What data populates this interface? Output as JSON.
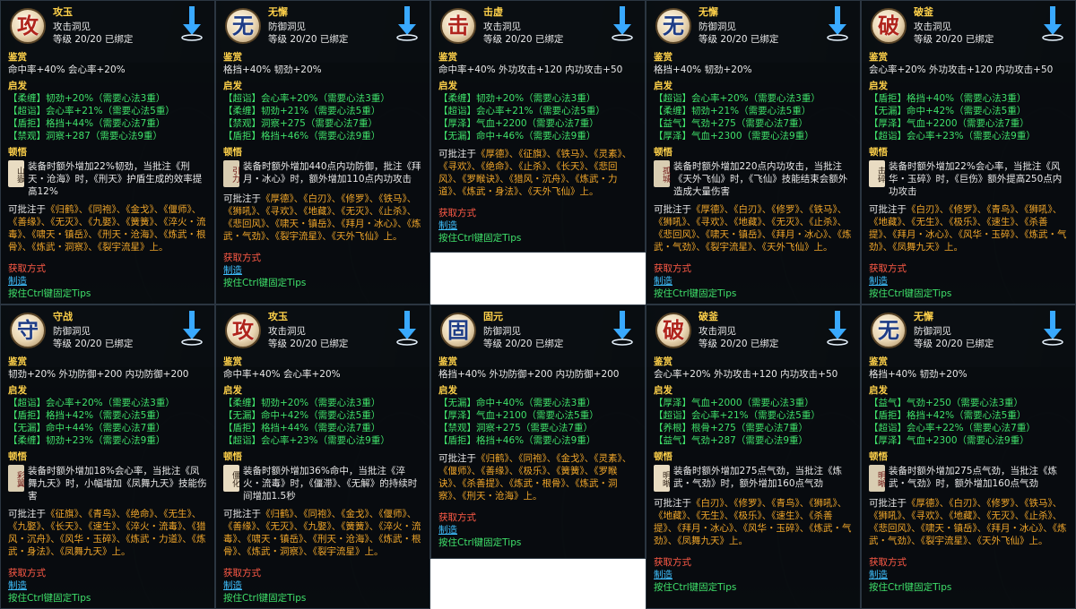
{
  "labels": {
    "appreciate": "鉴赏",
    "inspire": "启发",
    "insight": "顿悟",
    "acquire": "获取方式",
    "make": "制造",
    "hint": "按住Ctrl键固定Tips",
    "can_batch": "可批注于"
  },
  "tooltips": [
    {
      "glyph": "攻",
      "kind": "att",
      "name": "攻玉",
      "type": "攻击洞见",
      "level": "等级 20/20 已绑定",
      "appreciate": "命中率+40% 会心率+20%",
      "inspire": [
        {
          "tag": "【柔缠】",
          "stat": "韧劲+20%",
          "req": "（需要心法3重）"
        },
        {
          "tag": "【超诣】",
          "stat": "会心率+21%",
          "req": "（需要心法5重）"
        },
        {
          "tag": "【盾拒】",
          "stat": "格挡+44%",
          "req": "（需要心法7重）"
        },
        {
          "tag": "【禁观】",
          "stat": "洞察+287",
          "req": "（需要心法9重）"
        }
      ],
      "seal": "山嶽",
      "desc": "装备时额外增加22%韧劲，当批注《刑天・沧海》时，《刑天》护盾生成的效率提高12%",
      "books": "《归鹤》、《同袍》、《金戈》、《偃师》、《善缘》、《无灭》、《九娶》、《簧簧》、《淬火・流毒》、《啸天・镇岳》、《刑天・沧海》、《炼武・根骨》、《炼武・洞察》、《裂宇流星》上。"
    },
    {
      "glyph": "无",
      "kind": "def",
      "name": "无懈",
      "type": "防御洞见",
      "level": "等级 20/20 已绑定",
      "appreciate": "格挡+40% 韧劲+20%",
      "inspire": [
        {
          "tag": "【超诣】",
          "stat": "会心率+20%",
          "req": "（需要心法3重）"
        },
        {
          "tag": "【柔缠】",
          "stat": "韧劲+21%",
          "req": "（需要心法5重）"
        },
        {
          "tag": "【禁观】",
          "stat": "洞察+275",
          "req": "（需要心法7重）"
        },
        {
          "tag": "【盾拒】",
          "stat": "格挡+46%",
          "req": "（需要心法9重）"
        }
      ],
      "seal": "引力",
      "desc": "装备时额外增加440点内功防御，批注《拜月・冰心》时，额外增加110点内功攻击",
      "books": "《厚德》、《白刃》、《修罗》、《铁马》、《狮吼》、《寻欢》、《地藏》、《无灭》、《止杀》、《悲回风》、《啸天・镇岳》、《拜月・冰心》、《炼武・气劲》、《裂宇流星》、《天外飞仙》上。"
    },
    {
      "glyph": "击",
      "kind": "att",
      "name": "击虚",
      "type": "攻击洞见",
      "level": "等级 20/20 已绑定",
      "appreciate": "命中率+40% 外功攻击+120 内功攻击+50",
      "inspire": [
        {
          "tag": "【柔缠】",
          "stat": "韧劲+20%",
          "req": "（需要心法3重）"
        },
        {
          "tag": "【超诣】",
          "stat": "会心率+21%",
          "req": "（需要心法5重）"
        },
        {
          "tag": "【厚泽】",
          "stat": "气血+2200",
          "req": "（需要心法7重）"
        },
        {
          "tag": "【无漏】",
          "stat": "命中+46%",
          "req": "（需要心法9重）"
        }
      ],
      "seal": "",
      "desc": "",
      "books": "《厚德》、《征旗》、《铁马》、《灵素》、《寻欢》、《绝命》、《止杀》、《长天》、《悲回风》、《罗睺诀》、《猎风・沉舟》、《炼武・力道》、《炼武・身法》、《天外飞仙》上。"
    },
    {
      "glyph": "无",
      "kind": "def",
      "name": "无懈",
      "type": "防御洞见",
      "level": "等级 20/20 已绑定",
      "appreciate": "格挡+40% 韧劲+20%",
      "inspire": [
        {
          "tag": "【超诣】",
          "stat": "会心率+20%",
          "req": "（需要心法3重）"
        },
        {
          "tag": "【柔缠】",
          "stat": "韧劲+21%",
          "req": "（需要心法5重）"
        },
        {
          "tag": "【益气】",
          "stat": "气劲+275",
          "req": "（需要心法7重）"
        },
        {
          "tag": "【厚泽】",
          "stat": "气血+2300",
          "req": "（需要心法9重）"
        }
      ],
      "seal": "孤城",
      "desc": "装备时额外增加220点内功攻击，当批注《天外飞仙》时，《飞仙》技能结束会额外造成大量伤害",
      "books": "《厚德》、《白刃》、《修罗》、《铁马》、《狮吼》、《寻欢》、《地藏》、《无灭》、《止杀》、《悲回风》、《啸天・镇岳》、《拜月・冰心》、《炼武・气劲》、《裂宇流星》、《天外飞仙》上。"
    },
    {
      "glyph": "破",
      "kind": "att",
      "name": "破釜",
      "type": "攻击洞见",
      "level": "等级 20/20 已绑定",
      "appreciate": "会心率+20% 外功攻击+120 内功攻击+50",
      "inspire": [
        {
          "tag": "【盾拒】",
          "stat": "格挡+40%",
          "req": "（需要心法3重）"
        },
        {
          "tag": "【无漏】",
          "stat": "命中+42%",
          "req": "（需要心法5重）"
        },
        {
          "tag": "【厚泽】",
          "stat": "气血+2200",
          "req": "（需要心法7重）"
        },
        {
          "tag": "【超诣】",
          "stat": "会心率+23%",
          "req": "（需要心法9重）"
        }
      ],
      "seal": "击碎",
      "desc": "装备时额外增加22%会心率，当批注《风华・玉碎》时，《巨伤》额外提高250点内功攻击",
      "books": "《白刃》、《修罗》、《青鸟》、《狮吼》、《地藏》、《无生》、《极乐》、《速生》、《杀善提》、《拜月・冰心》、《风华・玉碎》、《炼武・气劲》、《凤舞九天》上。"
    },
    {
      "glyph": "守",
      "kind": "def",
      "name": "守战",
      "type": "防御洞见",
      "level": "等级 20/20 已绑定",
      "appreciate": "韧劲+20% 外功防御+200 内功防御+200",
      "inspire": [
        {
          "tag": "【超诣】",
          "stat": "会心率+20%",
          "req": "（需要心法3重）"
        },
        {
          "tag": "【盾拒】",
          "stat": "格挡+42%",
          "req": "（需要心法5重）"
        },
        {
          "tag": "【无漏】",
          "stat": "命中+44%",
          "req": "（需要心法7重）"
        },
        {
          "tag": "【柔缠】",
          "stat": "韧劲+23%",
          "req": "（需要心法9重）"
        }
      ],
      "seal": "彩翼",
      "desc": "装备时额外增加18%会心率，当批注《凤舞九天》时，小幅增加《凤舞九天》技能伤害",
      "books": "《征旗》、《青鸟》、《绝命》、《无生》、《九娶》、《长天》、《速生》、《淬火・流毒》、《猎风・沉舟》、《风华・玉碎》、《炼武・力道》、《炼武・身法》、《凤舞九天》上。"
    },
    {
      "glyph": "攻",
      "kind": "att",
      "name": "攻玉",
      "type": "攻击洞见",
      "level": "等级 20/20 已绑定",
      "appreciate": "命中率+40% 会心率+20%",
      "inspire": [
        {
          "tag": "【柔缠】",
          "stat": "韧劲+20%",
          "req": "（需要心法3重）"
        },
        {
          "tag": "【无漏】",
          "stat": "命中+42%",
          "req": "（需要心法5重）"
        },
        {
          "tag": "【盾拒】",
          "stat": "格挡+44%",
          "req": "（需要心法7重）"
        },
        {
          "tag": "【超诣】",
          "stat": "会心率+23%",
          "req": "（需要心法9重）"
        }
      ],
      "seal": "僵化",
      "desc": "装备时额外增加36%命中，当批注《淬火・流毒》时，《僵滞》、《无解》的持续时间增加1.5秒",
      "books": "《归鹤》、《同袍》、《金戈》、《偃师》、《善缘》、《无灭》、《九娶》、《簧簧》、《淬火・流毒》、《啸天・镇岳》、《刑天・沧海》、《炼武・根骨》、《炼武・洞察》、《裂宇流星》上。"
    },
    {
      "glyph": "固",
      "kind": "def",
      "name": "固元",
      "type": "防御洞见",
      "level": "等级 20/20 已绑定",
      "appreciate": "格挡+40% 外功防御+200 内功防御+200",
      "inspire": [
        {
          "tag": "【无漏】",
          "stat": "命中+40%",
          "req": "（需要心法3重）"
        },
        {
          "tag": "【厚泽】",
          "stat": "气血+2100",
          "req": "（需要心法5重）"
        },
        {
          "tag": "【禁观】",
          "stat": "洞察+275",
          "req": "（需要心法7重）"
        },
        {
          "tag": "【盾拒】",
          "stat": "格挡+46%",
          "req": "（需要心法9重）"
        }
      ],
      "seal": "",
      "desc": "",
      "books": "《归鹤》、《同袍》、《金戈》、《灵素》、《偃师》、《善缘》、《极乐》、《簧簧》、《罗睺诀》、《杀善提》、《炼武・根骨》、《炼武・洞察》、《刑天・沧海》上。"
    },
    {
      "glyph": "破",
      "kind": "att",
      "name": "破釜",
      "type": "攻击洞见",
      "level": "等级 20/20 已绑定",
      "appreciate": "会心率+20% 外功攻击+120 内功攻击+50",
      "inspire": [
        {
          "tag": "【厚泽】",
          "stat": "气血+2000",
          "req": "（需要心法3重）"
        },
        {
          "tag": "【超诣】",
          "stat": "会心率+21%",
          "req": "（需要心法5重）"
        },
        {
          "tag": "【养根】",
          "stat": "根骨+275",
          "req": "（需要心法7重）"
        },
        {
          "tag": "【益气】",
          "stat": "气劲+287",
          "req": "（需要心法9重）"
        }
      ],
      "seal": "明晰",
      "desc": "装备时额外增加275点气劲，当批注《炼武・气劲》时，额外增加160点气劲",
      "books": "《白刃》、《修罗》、《青鸟》、《狮吼》、《地藏》、《无生》、《极乐》、《速生》、《杀善提》、《拜月・冰心》、《风华・玉碎》、《炼武・气劲》、《凤舞九天》上。"
    },
    {
      "glyph": "无",
      "kind": "def",
      "name": "无懈",
      "type": "防御洞见",
      "level": "等级 20/20 已绑定",
      "appreciate": "格挡+40% 韧劲+20%",
      "inspire": [
        {
          "tag": "【益气】",
          "stat": "气劲+250",
          "req": "（需要心法3重）"
        },
        {
          "tag": "【盾拒】",
          "stat": "格挡+42%",
          "req": "（需要心法5重）"
        },
        {
          "tag": "【超诣】",
          "stat": "会心率+22%",
          "req": "（需要心法7重）"
        },
        {
          "tag": "【厚泽】",
          "stat": "气血+2300",
          "req": "（需要心法9重）"
        }
      ],
      "seal": "明晰",
      "desc": "装备时额外增加275点气劲，当批注《炼武・气劲》时，额外增加160点气劲",
      "books": "《厚德》、《白刃》、《修罗》、《铁马》、《狮吼》、《寻欢》、《地藏》、《无灭》、《止杀》、《悲回风》、《啸天・镇岳》、《拜月・冰心》、《炼武・气劲》、《裂宇流星》、《天外飞仙》上。"
    }
  ]
}
